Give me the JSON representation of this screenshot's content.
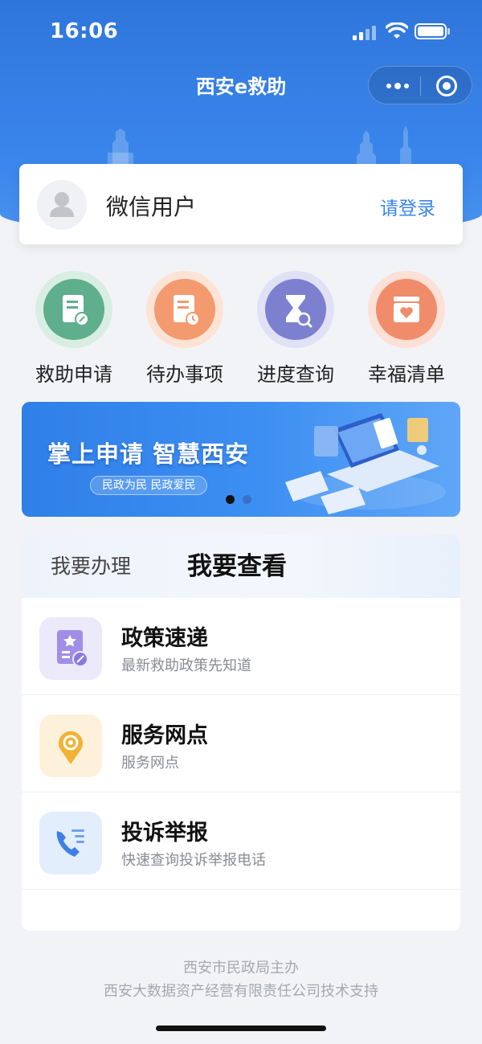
{
  "status_bar": {
    "time": "16:06"
  },
  "header": {
    "title": "西安e救助"
  },
  "user": {
    "name": "微信用户",
    "login_label": "请登录"
  },
  "quick_actions": [
    {
      "label": "救助申请",
      "icon": "application-form-icon",
      "color": "#5fae8c"
    },
    {
      "label": "待办事项",
      "icon": "todo-clock-icon",
      "color": "#f39a6e"
    },
    {
      "label": "进度查询",
      "icon": "hourglass-search-icon",
      "color": "#7c80cf"
    },
    {
      "label": "幸福清单",
      "icon": "heart-box-icon",
      "color": "#f08c6a"
    }
  ],
  "banner": {
    "title": "掌上申请 智慧西安",
    "tagline": "民政为民  民政爱民",
    "active_slide": 1,
    "slide_count": 2
  },
  "tabs": {
    "handle": "我要办理",
    "view": "我要查看",
    "active": "我要查看"
  },
  "list": [
    {
      "title": "政策速递",
      "subtitle": "最新救助政策先知道",
      "icon": "policy-document-icon"
    },
    {
      "title": "服务网点",
      "subtitle": "服务网点",
      "icon": "location-pin-icon"
    },
    {
      "title": "投诉举报",
      "subtitle": "快速查询投诉举报电话",
      "icon": "phone-list-icon"
    }
  ],
  "footer": {
    "line1": "西安市民政局主办",
    "line2": "西安大数据资产经营有限责任公司技术支持"
  },
  "colors": {
    "primary": "#3a86ec",
    "background": "#f2f3f7"
  }
}
